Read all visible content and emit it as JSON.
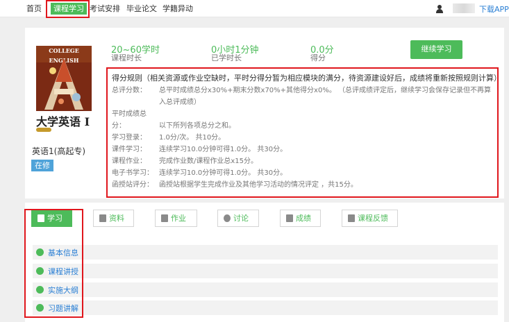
{
  "nav": {
    "items": [
      "首页",
      "课程学习",
      "考试安排",
      "毕业论文",
      "学籍异动"
    ],
    "app_link": "下载APP"
  },
  "course": {
    "cover_top": "COLLEGE ENGLISH",
    "cover_title": "大学英语 I",
    "name": "英语1(高起专)",
    "status": "在修"
  },
  "stats": [
    {
      "value": "20~60学时",
      "label": "课程时长"
    },
    {
      "value": "0小时1分钟",
      "label": "已学时长"
    },
    {
      "value": "0.0分",
      "label": "得分"
    }
  ],
  "continue_label": "继续学习",
  "rules": {
    "title": "得分规则（相关资源或作业空缺时，平时分得分暂为相应模块的满分，待资源建设好后，成绩将重新按照规则计算）",
    "rows": [
      {
        "label": "总评分数：",
        "text": "总平时成绩总分x30%+期末分数x70%+其他得分x0%。 （总评成绩评定后，继续学习会保存记录但不再算入总评成绩）"
      },
      {
        "label": "平时成绩总分：",
        "text": "以下所列各项总分之和。"
      },
      {
        "label": "学习登录：",
        "text": "1.0分/次。 共10分。"
      },
      {
        "label": "课件学习：",
        "text": "连续学习10.0分钟可得1.0分。 共30分。"
      },
      {
        "label": "课程作业：",
        "text": "完成作业数/课程作业总x15分。"
      },
      {
        "label": "电子书学习：",
        "text": "连续学习10.0分钟可得1.0分。 共30分。"
      },
      {
        "label": "函授站评分：",
        "text": "函授站根据学生完成作业及其他学习活动的情况评定 ，共15分。"
      }
    ]
  },
  "tabs": [
    "学习",
    "资料",
    "作业",
    "讨论",
    "成绩",
    "课程反馈"
  ],
  "list": [
    "基本信息",
    "课程讲授",
    "实施大纲",
    "习题讲解"
  ],
  "colors": {
    "accent": "#4dbb5a",
    "highlight_box": "#e0161c",
    "link": "#2a7fd4",
    "badge": "#4fa3d9"
  }
}
